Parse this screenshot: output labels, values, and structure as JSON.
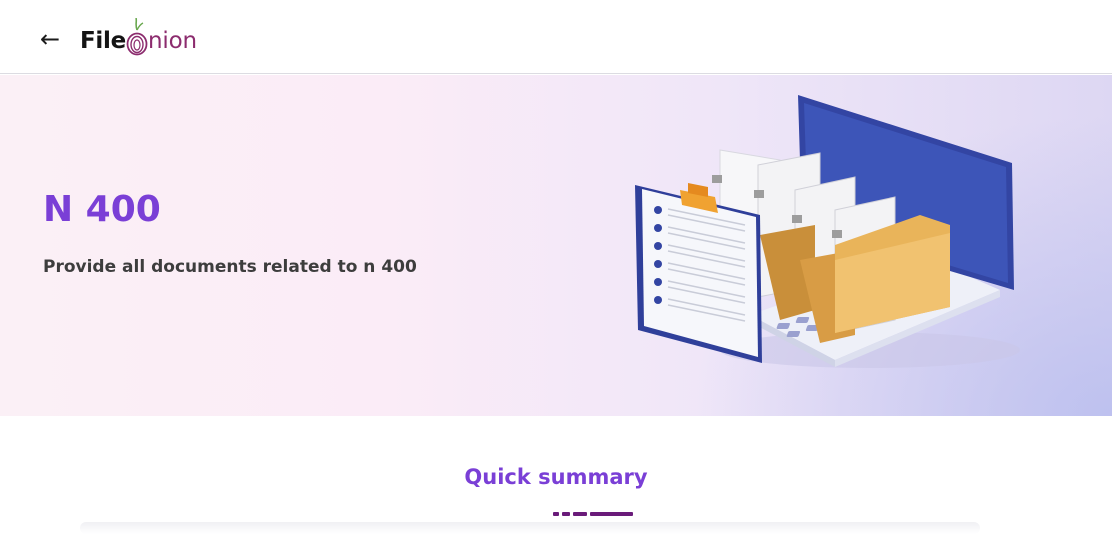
{
  "header": {
    "back_icon": "arrow-left-icon",
    "logo": {
      "text_left": "File",
      "text_right": "nion",
      "mark_icon": "onion-icon",
      "mark_color": "#8c2c6e",
      "leaf_color": "#6aa84f"
    }
  },
  "hero": {
    "title": "N 400",
    "subtitle": "Provide all documents related to n 400",
    "illustration_icon": "laptop-folders-illustration"
  },
  "summary": {
    "title": "Quick summary"
  },
  "colors": {
    "accent_purple": "#7a3fd6",
    "underline": "#6a1b7a",
    "laptop_blue": "#3345a3",
    "folder_gold": "#e9b45a"
  }
}
